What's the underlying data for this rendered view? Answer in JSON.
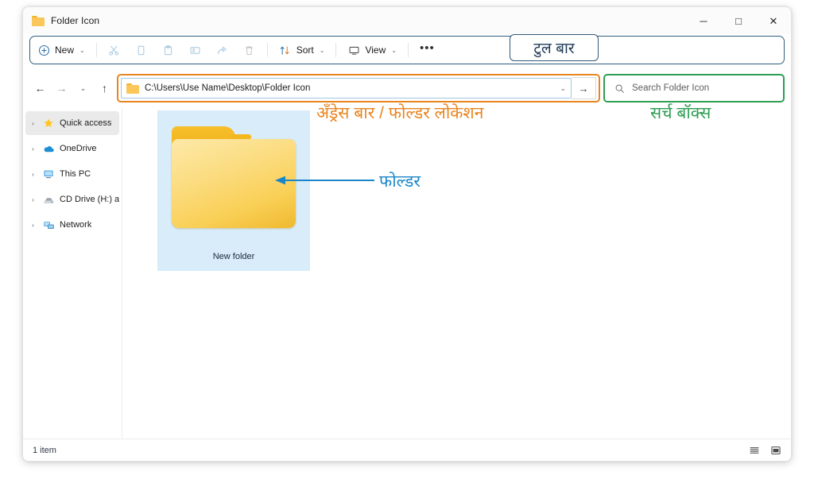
{
  "window": {
    "title": "Folder Icon",
    "controls": {
      "minimize": "─",
      "maximize": "□",
      "close": "✕"
    }
  },
  "toolbar": {
    "new_label": "New",
    "cut_label": "Cut",
    "copy_label": "Copy",
    "paste_label": "Paste",
    "rename_label": "Rename",
    "share_label": "Share",
    "delete_label": "Delete",
    "sort_label": "Sort",
    "view_label": "View",
    "more_label": "•••",
    "caret": "⌄"
  },
  "navigation": {
    "back": "←",
    "forward": "→",
    "recent": "⌄",
    "up": "↑"
  },
  "address": {
    "path": "C:\\Users\\Use Name\\Desktop\\Folder Icon",
    "dropdown": "⌄",
    "go": "→"
  },
  "search": {
    "placeholder": "Search Folder Icon"
  },
  "sidebar": {
    "items": [
      {
        "label": "Quick access",
        "chevron": "›",
        "icon": "star-icon",
        "selected": true
      },
      {
        "label": "OneDrive",
        "chevron": "›",
        "icon": "cloud-icon",
        "selected": false
      },
      {
        "label": "This PC",
        "chevron": "›",
        "icon": "monitor-icon",
        "selected": false
      },
      {
        "label": "CD Drive (H:) airtel",
        "chevron": "›",
        "icon": "disc-drive-icon",
        "selected": false
      },
      {
        "label": "Network",
        "chevron": "›",
        "icon": "network-icon",
        "selected": false
      }
    ]
  },
  "content": {
    "items": [
      {
        "name": "New folder",
        "icon": "folder-icon",
        "selected": true
      }
    ]
  },
  "statusbar": {
    "count_text": "1 item",
    "details_view": "details-view-icon",
    "large_icons_view": "large-icons-view-icon"
  },
  "annotations": {
    "toolbar": {
      "text": "टुल बार",
      "color": "#1f3a56"
    },
    "address": {
      "text": "अँड्रेस बार / फोल्डर लोकेशन",
      "color": "#e8851f"
    },
    "search": {
      "text": "सर्च बॉक्स",
      "color": "#2e9e54"
    },
    "folder": {
      "text": "फोल्डर",
      "color": "#1a86c8"
    }
  },
  "colors": {
    "annotation_orange": "#e8851f",
    "annotation_green": "#2e9e54",
    "annotation_blue": "#1a86c8",
    "annotation_navy": "#1f3a56",
    "selection_blue": "#d8ecfa",
    "folder_yellow": "#f9cf55"
  }
}
